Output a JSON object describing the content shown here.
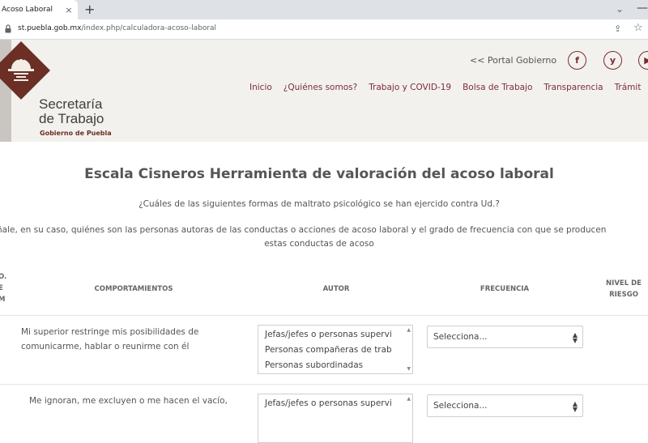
{
  "browser": {
    "tab_title": "Acoso Laboral",
    "tab_close": "×",
    "new_tab": "+",
    "tab_list": "⌄",
    "minimize": "—",
    "url_domain": "st.puebla.gob.mx",
    "url_path": "/index.php/calculadora-acoso-laboral",
    "icons": [
      "lock-icon",
      "share-icon",
      "star-icon"
    ]
  },
  "header": {
    "logo_line1": "Secretaría",
    "logo_line2": "de Trabajo",
    "logo_line3": "Gobierno de Puebla",
    "portal_link": "<< Portal Gobierno",
    "social": [
      "f",
      "y",
      "▶"
    ],
    "nav": [
      "Inicio",
      "¿Quiénes somos?",
      "Trabajo y COVID-19",
      "Bolsa de Trabajo",
      "Transparencia",
      "Trámit"
    ],
    "colors": {
      "brand": "#7a2e3a",
      "logo": "#6b2f25"
    }
  },
  "main": {
    "title": "Escala Cisneros Herramienta de valoración del acoso laboral",
    "question": "¿Cuáles de las siguientes formas de maltrato psicológico se han ejercido contra Ud.?",
    "instruction_line1": "ñale, en su caso, quiénes son las personas autoras de las conductas o acciones de acoso laboral y el grado de frecuencia con que se producen",
    "instruction_line2": "estas conductas de acoso"
  },
  "table": {
    "headers": {
      "num": "O.\nE\nM",
      "behaviors": "COMPORTAMIENTOS",
      "author": "AUTOR",
      "frequency": "FRECUENCIA",
      "risk": "NIVEL DE\nRIESGO"
    },
    "rows": [
      {
        "behavior_line1": "Mi superior restringe mis posibilidades de",
        "behavior_line2": "comunicarme, hablar o reunirme con él",
        "author_options": [
          "Jefas/jefes o personas supervi",
          "Personas compañeras de trab",
          "Personas subordinadas"
        ],
        "frequency": "Selecciona..."
      },
      {
        "behavior_line1": "Me ignoran, me excluyen o me hacen el vacío,",
        "author_options": [
          "Jefas/jefes o personas supervi"
        ],
        "frequency": "Selecciona..."
      }
    ]
  }
}
